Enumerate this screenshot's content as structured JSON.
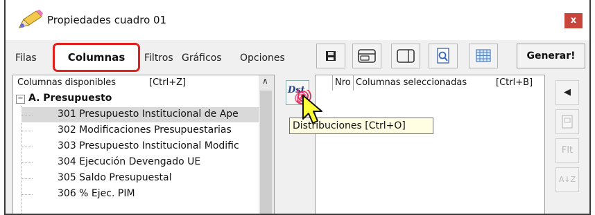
{
  "window": {
    "title": "Propiedades cuadro 01",
    "close_label": "x"
  },
  "tabs": [
    "Filas",
    "Columnas",
    "Filtros",
    "Gráficos",
    "Opciones"
  ],
  "toolbar": {
    "generate_label": "Generar!"
  },
  "available_columns": {
    "header": "Columnas disponibles",
    "shortcut": "[Ctrl+Z]",
    "group": {
      "toggle": "−",
      "label": "A. Presupuesto"
    },
    "items": [
      "301 Presupuesto Institucional de Ape",
      "302 Modificaciones Presupuestarias",
      "303 Presupuesto Institucional Modific",
      "304 Ejecución Devengado UE",
      "305 Saldo Presupuestal",
      "306 % Ejec. PIM"
    ],
    "selected_index": 0
  },
  "selected_columns": {
    "nro_label": "Nro",
    "header": "Columnas seleccionadas",
    "shortcut": "[Ctrl+B]"
  },
  "distributions_button": {
    "glyph": "Dst"
  },
  "tooltip": {
    "text": "Distribuciones [Ctrl+O]"
  },
  "side_buttons": {
    "move_left": "◀",
    "filter": "Flt",
    "sort": "A↓Z"
  },
  "colors": {
    "highlight_red": "#e0201c",
    "close_red": "#c7453a",
    "tooltip_bg": "#fffee3",
    "cursor_yellow": "#ffff3a"
  }
}
